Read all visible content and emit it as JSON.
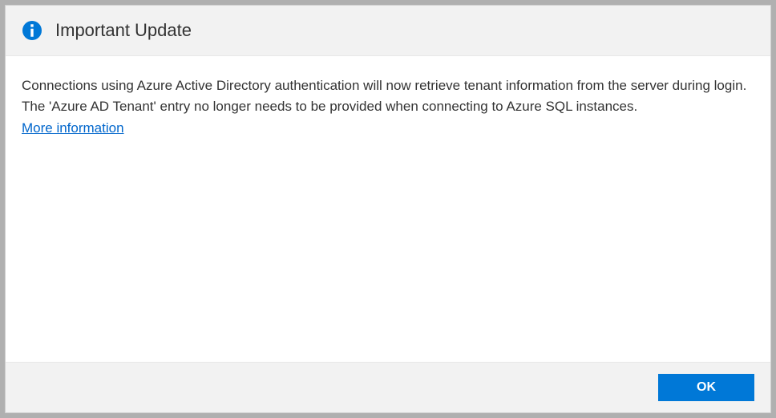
{
  "dialog": {
    "title": "Important Update",
    "message": "Connections using Azure Active Directory authentication will now retrieve tenant information from the server during login. The 'Azure AD Tenant' entry no longer needs to be provided when connecting to Azure SQL instances.",
    "link_label": "More information",
    "ok_label": "OK"
  },
  "colors": {
    "accent": "#0078d7",
    "link": "#0066cc"
  }
}
